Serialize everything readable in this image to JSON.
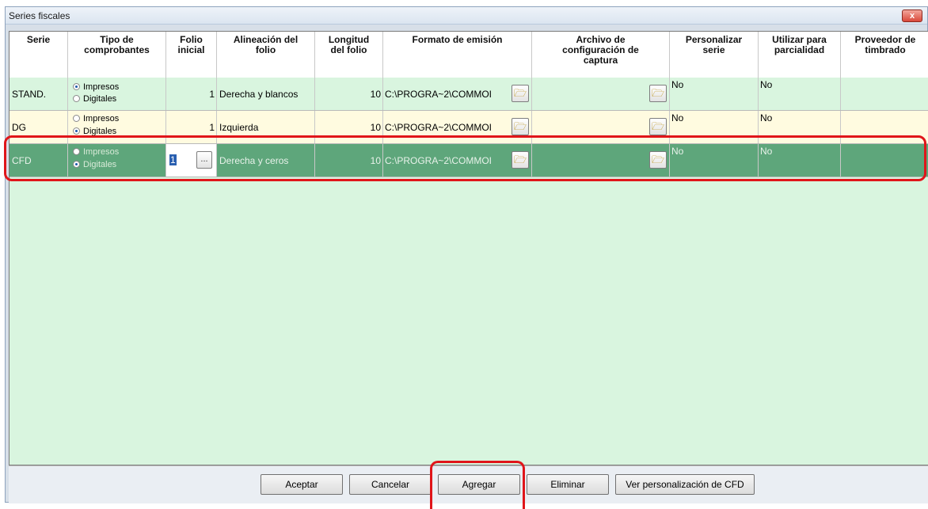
{
  "window": {
    "title": "Series fiscales",
    "close_label": "x"
  },
  "columns": [
    {
      "label": "Serie"
    },
    {
      "label": "Tipo de comprobantes"
    },
    {
      "label": "Folio inicial"
    },
    {
      "label": "Alineación del folio"
    },
    {
      "label": "Longitud del folio"
    },
    {
      "label": "Formato de emisión"
    },
    {
      "label": "Archivo de configuración de captura"
    },
    {
      "label": "Personalizar serie"
    },
    {
      "label": "Utilizar para parcialidad"
    },
    {
      "label": "Proveedor de timbrado"
    }
  ],
  "radio_labels": {
    "impresos": "Impresos",
    "digitales": "Digitales"
  },
  "rows": [
    {
      "serie": "STAND.",
      "tipo_selected": "impresos",
      "folio_inicial": "1",
      "alineacion": "Derecha y blancos",
      "longitud": "10",
      "formato": "C:\\PROGRA~2\\COMMOI",
      "archivo": "",
      "personalizar": "No",
      "parcialidad": "No",
      "proveedor": "",
      "selected": false
    },
    {
      "serie": "DG",
      "tipo_selected": "digitales",
      "folio_inicial": "1",
      "alineacion": "Izquierda",
      "longitud": "10",
      "formato": "C:\\PROGRA~2\\COMMOI",
      "archivo": "",
      "personalizar": "No",
      "parcialidad": "No",
      "proveedor": "",
      "selected": false
    },
    {
      "serie": "CFD",
      "tipo_selected": "digitales",
      "folio_inicial": "1",
      "alineacion": "Derecha y ceros",
      "longitud": "10",
      "formato": "C:\\PROGRA~2\\COMMOI",
      "archivo": "",
      "personalizar": "No",
      "parcialidad": "No",
      "proveedor": "",
      "selected": true
    }
  ],
  "folio_picker_label": "...",
  "buttons": {
    "aceptar": "Aceptar",
    "cancelar": "Cancelar",
    "agregar": "Agregar",
    "eliminar": "Eliminar",
    "ver_personalizacion": "Ver personalización de CFD"
  },
  "colors": {
    "row_stand": "#d9f5df",
    "row_dg": "#fffbe0",
    "row_selected": "#5ea67b",
    "highlight": "#e0151a"
  }
}
